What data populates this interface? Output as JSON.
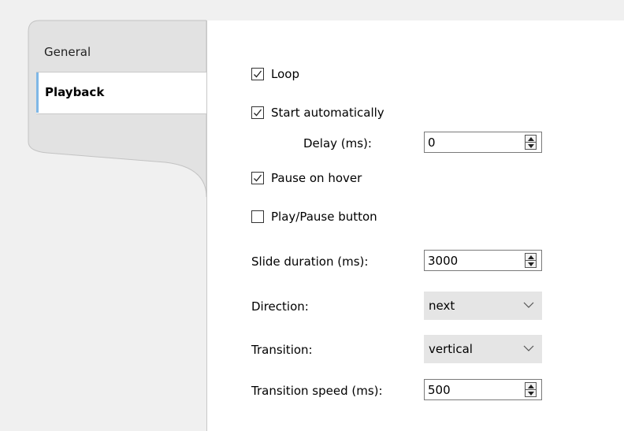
{
  "tabs": [
    {
      "label": "General",
      "selected": false
    },
    {
      "label": "Playback",
      "selected": true
    }
  ],
  "playback": {
    "loop": {
      "label": "Loop",
      "checked": true
    },
    "start_automatically": {
      "label": "Start automatically",
      "checked": true
    },
    "delay": {
      "label": "Delay (ms):",
      "value": "0"
    },
    "pause_on_hover": {
      "label": "Pause on hover",
      "checked": true
    },
    "play_pause_button": {
      "label": "Play/Pause button",
      "checked": false
    },
    "slide_duration": {
      "label": "Slide duration (ms):",
      "value": "3000"
    },
    "direction": {
      "label": "Direction:",
      "value": "next"
    },
    "transition": {
      "label": "Transition:",
      "value": "vertical"
    },
    "transition_speed": {
      "label": "Transition speed (ms):",
      "value": "500"
    }
  },
  "icons": {
    "checkmark": "check-icon",
    "spin_up": "arrow-up-icon",
    "spin_down": "arrow-down-icon",
    "dropdown": "chevron-down-icon"
  },
  "colors": {
    "selected_tab_accent": "#7fb7e6",
    "pane_background": "#ffffff",
    "window_background": "#f0f0f0",
    "dropdown_background": "#e5e5e5"
  }
}
